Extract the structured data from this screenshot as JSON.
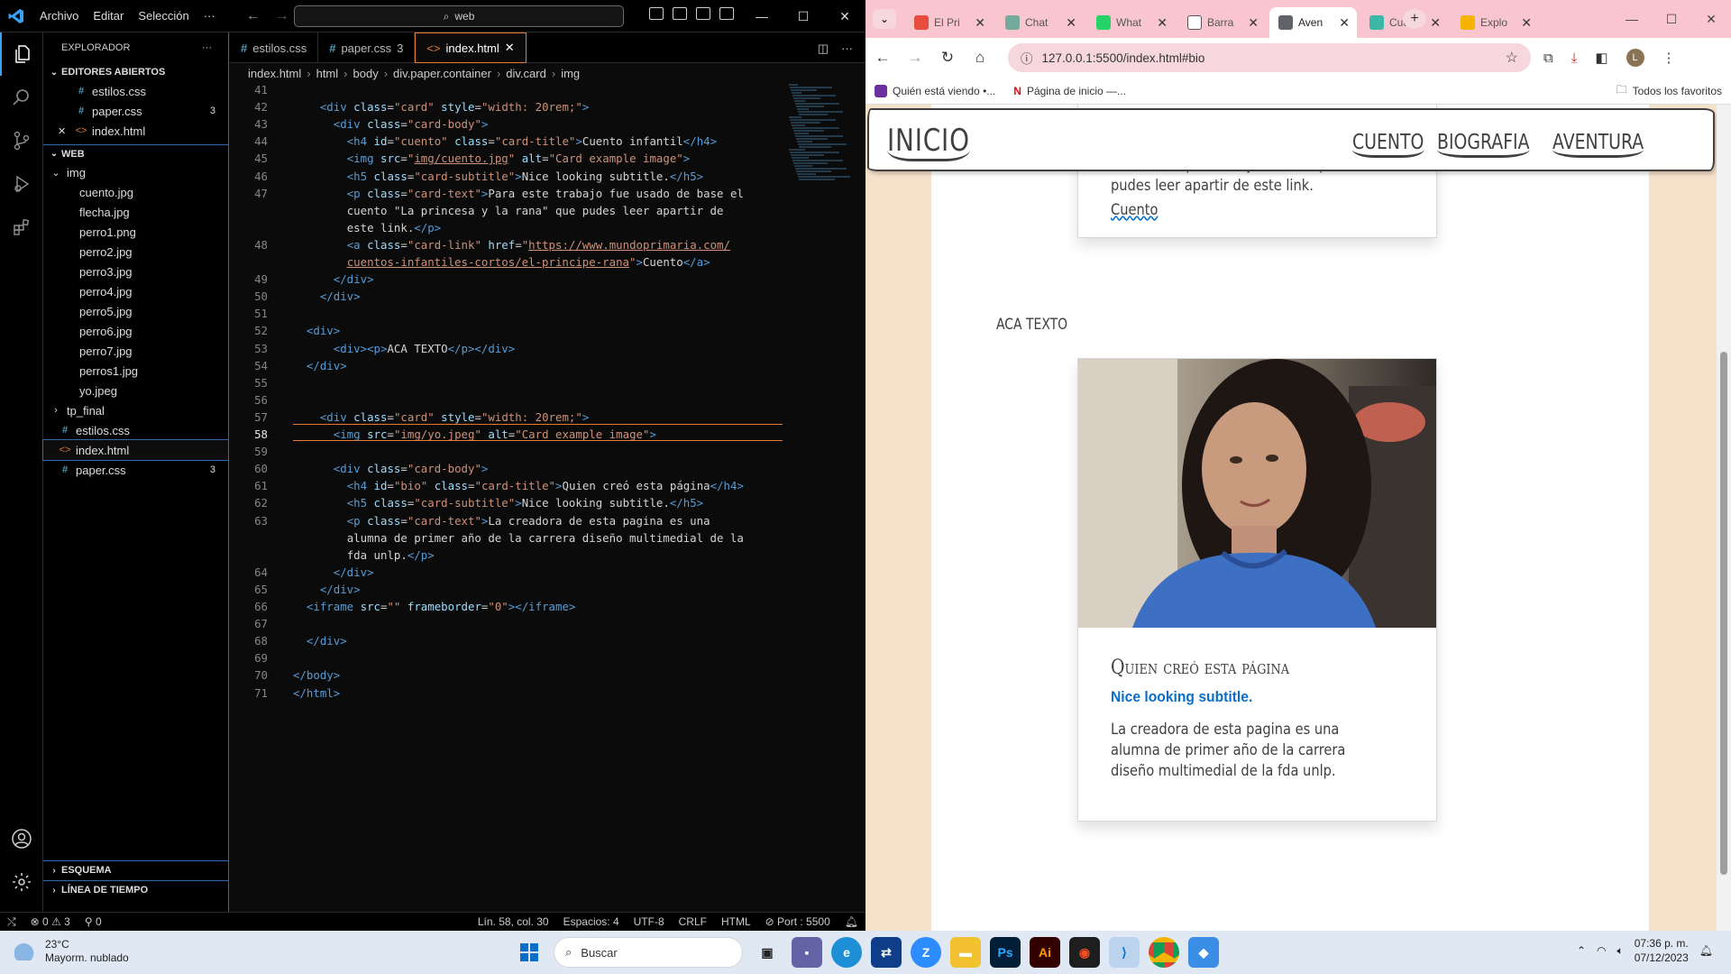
{
  "vscode": {
    "menu": [
      "Archivo",
      "Editar",
      "Selección",
      "···"
    ],
    "search": "web",
    "explorer_title": "EXPLORADOR",
    "open_editors_title": "EDITORES ABIERTOS",
    "open_editors": [
      {
        "name": "estilos.css",
        "type": "css",
        "badge": ""
      },
      {
        "name": "paper.css",
        "type": "css",
        "badge": "3"
      },
      {
        "name": "index.html",
        "type": "html",
        "badge": ""
      }
    ],
    "folder_title": "WEB",
    "tree": [
      {
        "name": "img",
        "kind": "folder-open"
      },
      {
        "name": "cuento.jpg",
        "kind": "img"
      },
      {
        "name": "flecha.jpg",
        "kind": "img"
      },
      {
        "name": "perro1.png",
        "kind": "img"
      },
      {
        "name": "perro2.jpg",
        "kind": "img"
      },
      {
        "name": "perro3.jpg",
        "kind": "img"
      },
      {
        "name": "perro4.jpg",
        "kind": "img"
      },
      {
        "name": "perro5.jpg",
        "kind": "img"
      },
      {
        "name": "perro6.jpg",
        "kind": "img"
      },
      {
        "name": "perro7.jpg",
        "kind": "img"
      },
      {
        "name": "perros1.jpg",
        "kind": "img"
      },
      {
        "name": "yo.jpeg",
        "kind": "img"
      },
      {
        "name": "tp_final",
        "kind": "folder"
      },
      {
        "name": "estilos.css",
        "kind": "css"
      },
      {
        "name": "index.html",
        "kind": "html"
      },
      {
        "name": "paper.css",
        "kind": "css",
        "badge": "3"
      }
    ],
    "outline_title": "ESQUEMA",
    "timeline_title": "LÍNEA DE TIEMPO",
    "tabs": [
      {
        "label": "estilos.css",
        "type": "css",
        "suffix": ""
      },
      {
        "label": "paper.css",
        "type": "css",
        "suffix": "3"
      },
      {
        "label": "index.html",
        "type": "html",
        "suffix": ""
      }
    ],
    "breadcrumbs": [
      "index.html",
      "html",
      "body",
      "div.paper.container",
      "div.card",
      "img"
    ],
    "current_line": 58,
    "lines": [
      {
        "n": "41",
        "html": ""
      },
      {
        "n": "42",
        "html": "    <span class='tg'>&lt;div</span> <span class='at'>class</span>=<span class='st'>\"card\"</span> <span class='at'>style</span>=<span class='st'>\"width: 20rem;\"</span><span class='tg'>&gt;</span>"
      },
      {
        "n": "43",
        "html": "      <span class='tg'>&lt;div</span> <span class='at'>class</span>=<span class='st'>\"card-body\"</span><span class='tg'>&gt;</span>"
      },
      {
        "n": "44",
        "html": "        <span class='tg'>&lt;h4</span> <span class='at'>id</span>=<span class='st'>\"cuento\"</span> <span class='at'>class</span>=<span class='st'>\"card-title\"</span><span class='tg'>&gt;</span><span class='tx'>Cuento infantil</span><span class='tg'>&lt;/h4&gt;</span>"
      },
      {
        "n": "45",
        "html": "        <span class='tg'>&lt;img</span> <span class='at'>src</span>=<span class='st'>\"</span><span class='lk'>img/cuento.jpg</span><span class='st'>\"</span> <span class='at'>alt</span>=<span class='st'>\"Card example image\"</span><span class='tg'>&gt;</span>"
      },
      {
        "n": "46",
        "html": "        <span class='tg'>&lt;h5</span> <span class='at'>class</span>=<span class='st'>\"card-subtitle\"</span><span class='tg'>&gt;</span><span class='tx'>Nice looking subtitle.</span><span class='tg'>&lt;/h5&gt;</span>"
      },
      {
        "n": "47",
        "html": "        <span class='tg'>&lt;p</span> <span class='at'>class</span>=<span class='st'>\"card-text\"</span><span class='tg'>&gt;</span><span class='tx'>Para este trabajo fue usado de base el</span>"
      },
      {
        "n": "",
        "html": "        <span class='tx'>cuento \"La princesa y la rana\" que pudes leer apartir de</span>"
      },
      {
        "n": "",
        "html": "        <span class='tx'>este link.</span><span class='tg'>&lt;/p&gt;</span>"
      },
      {
        "n": "48",
        "html": "        <span class='tg'>&lt;a</span> <span class='at'>class</span>=<span class='st'>\"card-link\"</span> <span class='at'>href</span>=<span class='st'>\"</span><span class='lk'>https://www.mundoprimaria.com/</span>"
      },
      {
        "n": "",
        "html": "        <span class='lk'>cuentos-infantiles-cortos/el-principe-rana</span><span class='st'>\"</span><span class='tg'>&gt;</span><span class='tx'>Cuento</span><span class='tg'>&lt;/a&gt;</span>"
      },
      {
        "n": "49",
        "html": "      <span class='tg'>&lt;/div&gt;</span>"
      },
      {
        "n": "50",
        "html": "    <span class='tg'>&lt;/div&gt;</span>"
      },
      {
        "n": "51",
        "html": ""
      },
      {
        "n": "52",
        "html": "  <span class='tg'>&lt;div&gt;</span>"
      },
      {
        "n": "53",
        "html": "      <span class='tg'>&lt;div&gt;&lt;p&gt;</span><span class='tx'>ACA TEXTO</span><span class='tg'>&lt;/p&gt;&lt;/div&gt;</span>"
      },
      {
        "n": "54",
        "html": "  <span class='tg'>&lt;/div&gt;</span>"
      },
      {
        "n": "55",
        "html": ""
      },
      {
        "n": "56",
        "html": ""
      },
      {
        "n": "57",
        "html": "    <span class='tg'>&lt;div</span> <span class='at'>class</span>=<span class='st'>\"card\"</span> <span class='at'>style</span>=<span class='st'>\"width: 20rem;\"</span><span class='tg'>&gt;</span>"
      },
      {
        "n": "58",
        "html": "      <span class='tg'>&lt;img</span> <span class='at'>src</span>=<span class='st'>\"img/yo.jpeg\"</span> <span class='at'>alt</span>=<span class='st'>\"Card example image\"</span><span class='tg'>&gt;</span>"
      },
      {
        "n": "59",
        "html": ""
      },
      {
        "n": "60",
        "html": "      <span class='tg'>&lt;div</span> <span class='at'>class</span>=<span class='st'>\"card-body\"</span><span class='tg'>&gt;</span>"
      },
      {
        "n": "61",
        "html": "        <span class='tg'>&lt;h4</span> <span class='at'>id</span>=<span class='st'>\"bio\"</span> <span class='at'>class</span>=<span class='st'>\"card-title\"</span><span class='tg'>&gt;</span><span class='tx'>Quien creó esta página</span><span class='tg'>&lt;/h4&gt;</span>"
      },
      {
        "n": "62",
        "html": "        <span class='tg'>&lt;h5</span> <span class='at'>class</span>=<span class='st'>\"card-subtitle\"</span><span class='tg'>&gt;</span><span class='tx'>Nice looking subtitle.</span><span class='tg'>&lt;/h5&gt;</span>"
      },
      {
        "n": "63",
        "html": "        <span class='tg'>&lt;p</span> <span class='at'>class</span>=<span class='st'>\"card-text\"</span><span class='tg'>&gt;</span><span class='tx'>La creadora de esta pagina es una</span>"
      },
      {
        "n": "",
        "html": "        <span class='tx'>alumna de primer año de la carrera diseño multimedial de la</span>"
      },
      {
        "n": "",
        "html": "        <span class='tx'>fda unlp.</span><span class='tg'>&lt;/p&gt;</span>"
      },
      {
        "n": "64",
        "html": "      <span class='tg'>&lt;/div&gt;</span>"
      },
      {
        "n": "65",
        "html": "    <span class='tg'>&lt;/div&gt;</span>"
      },
      {
        "n": "66",
        "html": "  <span class='tg'>&lt;iframe</span> <span class='at'>src</span>=<span class='st'>\"\"</span> <span class='at'>frameborder</span>=<span class='st'>\"0\"</span><span class='tg'>&gt;&lt;/iframe&gt;</span>"
      },
      {
        "n": "67",
        "html": ""
      },
      {
        "n": "68",
        "html": "  <span class='tg'>&lt;/div&gt;</span>"
      },
      {
        "n": "69",
        "html": ""
      },
      {
        "n": "70",
        "html": "<span class='tg'>&lt;/body&gt;</span>"
      },
      {
        "n": "71",
        "html": "<span class='tg'>&lt;/html&gt;</span>"
      }
    ],
    "status": {
      "errors": "0",
      "warnings": "3",
      "ports": "0",
      "position": "Lín. 58, col. 30",
      "spaces": "Espacios: 4",
      "encoding": "UTF-8",
      "eol": "CRLF",
      "language": "HTML",
      "port": "Port : 5500"
    }
  },
  "chrome": {
    "tabs": [
      {
        "label": "El Pri",
        "color": "#e84c3d"
      },
      {
        "label": "Chat",
        "color": "#74aa9c"
      },
      {
        "label": "What",
        "color": "#25d366"
      },
      {
        "label": "Barra",
        "color": "#ffffff"
      },
      {
        "label": "Aven",
        "color": "#5f6368"
      },
      {
        "label": "Cuen",
        "color": "#3bb8a8"
      },
      {
        "label": "Explo",
        "color": "#f4b400"
      }
    ],
    "active_tab_index": 4,
    "url": "127.0.0.1:5500/index.html#bio",
    "bookmarks": [
      {
        "label": "Quién está viendo •...",
        "color": "#6b2fa0"
      },
      {
        "label": "Página de inicio —...",
        "color": "#e50914"
      }
    ],
    "all_bookmarks": "Todos los favoritos",
    "profile_initial": "L"
  },
  "site": {
    "brand": "INICIO",
    "links": [
      "CUENTO",
      "BIOGRAFIA",
      "AVENTURA"
    ],
    "card1": {
      "text": "Para este trabajo fue usado de base el cuento \"La princesa y la rana\" que pudes leer apartir de este link.",
      "link": "Cuento"
    },
    "aca_texto": "ACA TEXTO",
    "card2": {
      "title": "Quien creó esta página",
      "subtitle": "Nice looking subtitle.",
      "text": "La creadora de esta pagina es una alumna de primer año de la carrera diseño multimedial de la fda unlp."
    }
  },
  "taskbar": {
    "temperature": "23°C",
    "weather": "Mayorm. nublado",
    "search": "Buscar",
    "time": "07:36 p. m.",
    "date": "07/12/2023"
  }
}
